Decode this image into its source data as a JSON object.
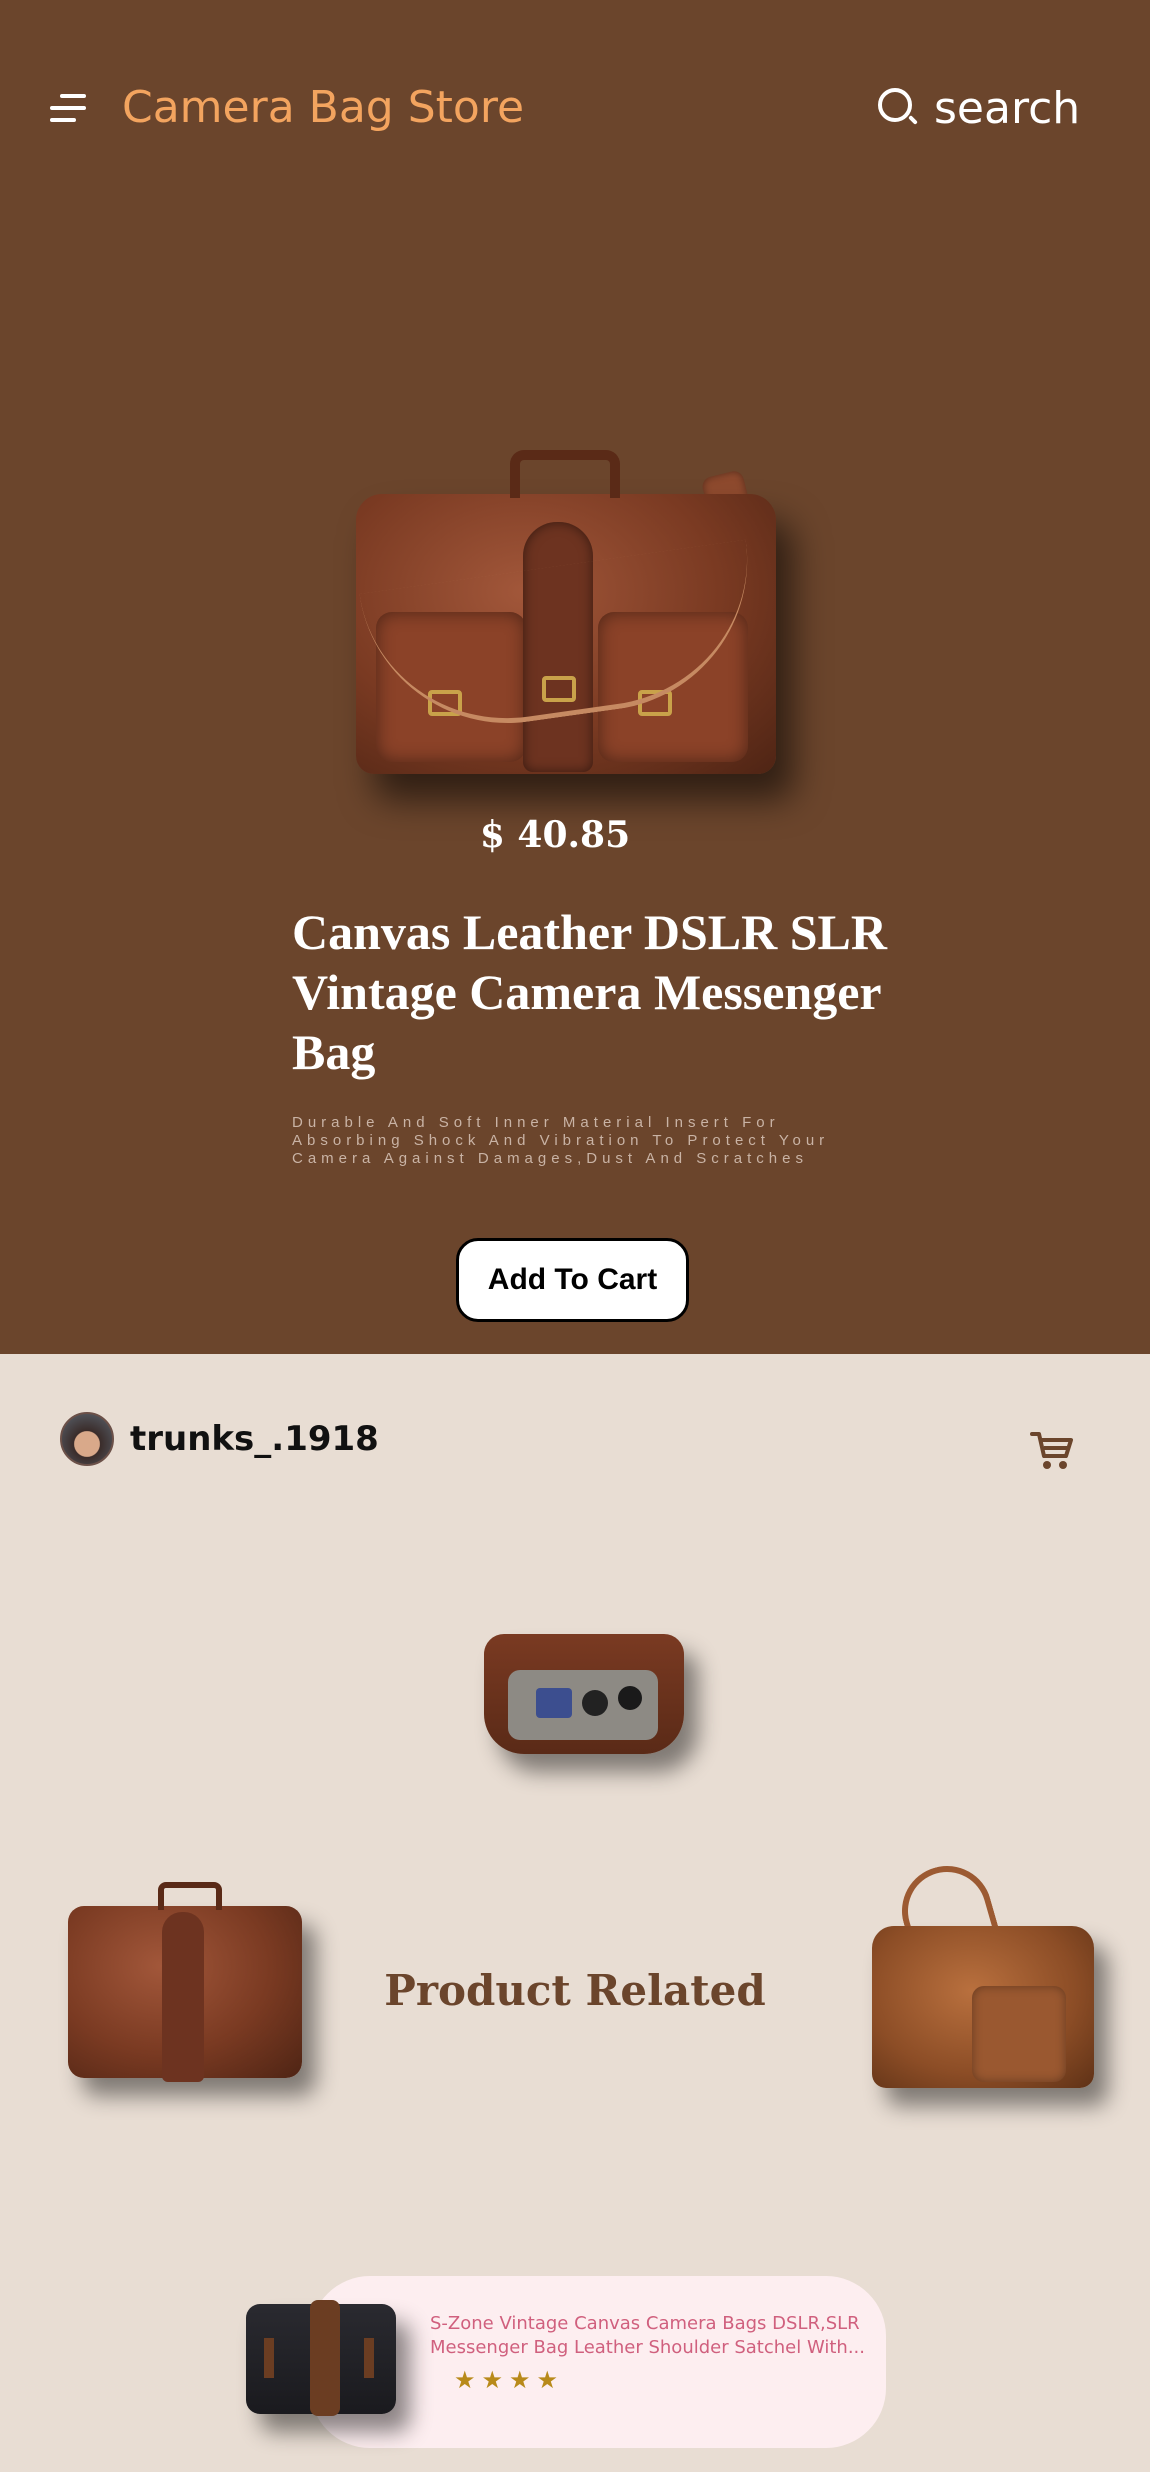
{
  "header": {
    "brand": "Camera Bag Store",
    "search_label": "search"
  },
  "product": {
    "price": "$ 40.85",
    "title": "Canvas Leather DSLR SLR Vintage Camera Messenger Bag",
    "description_line1": "Durable And Soft Inner Material Insert For Absorbing Shock And Vibration To Protect Your",
    "description_line2": "Camera Against Damages,Dust And Scratches",
    "add_to_cart_label": "Add To Cart"
  },
  "user": {
    "username": "trunks_.1918"
  },
  "related": {
    "title": "Product Related",
    "card": {
      "title": "S-Zone Vintage Canvas Camera Bags DSLR,SLR Messenger Bag Leather Shoulder Satchel With...",
      "stars": "★★★★",
      "rating": 4
    }
  },
  "colors": {
    "hero_background": "#6b452c",
    "lower_background": "#e8ddd3",
    "brand_accent": "#f3a45f",
    "card_background": "#fdeef0",
    "card_text": "#d0607e",
    "star_color": "#b88a1a"
  }
}
